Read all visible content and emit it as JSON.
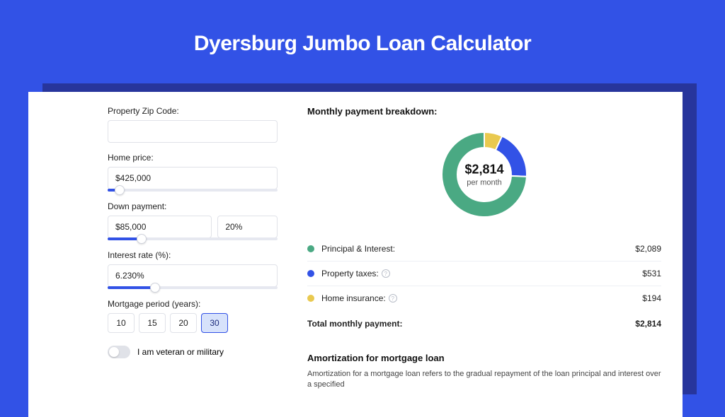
{
  "page": {
    "title": "Dyersburg Jumbo Loan Calculator"
  },
  "form": {
    "zip_label": "Property Zip Code:",
    "zip_value": "",
    "home_price_label": "Home price:",
    "home_price_value": "$425,000",
    "home_price_slider_pct": 7,
    "down_label": "Down payment:",
    "down_value": "$85,000",
    "down_pct_value": "20%",
    "down_slider_pct": 20,
    "rate_label": "Interest rate (%):",
    "rate_value": "6.230%",
    "rate_slider_pct": 28,
    "period_label": "Mortgage period (years):",
    "periods": [
      "10",
      "15",
      "20",
      "30"
    ],
    "period_active": "30",
    "veteran_label": "I am veteran or military",
    "veteran_on": false
  },
  "breakdown": {
    "title": "Monthly payment breakdown:",
    "total_amount": "$2,814",
    "total_sub": "per month",
    "items": [
      {
        "label": "Principal & Interest:",
        "amount": "$2,089",
        "color": "#4aa983",
        "has_info": false
      },
      {
        "label": "Property taxes:",
        "amount": "$531",
        "color": "#3252e6",
        "has_info": true
      },
      {
        "label": "Home insurance:",
        "amount": "$194",
        "color": "#e9c94f",
        "has_info": true
      }
    ],
    "total_label": "Total monthly payment:",
    "total_value": "$2,814"
  },
  "chart_data": {
    "type": "pie",
    "title": "Monthly payment breakdown",
    "series": [
      {
        "name": "Principal & Interest",
        "value": 2089,
        "color": "#4aa983"
      },
      {
        "name": "Property taxes",
        "value": 531,
        "color": "#3252e6"
      },
      {
        "name": "Home insurance",
        "value": 194,
        "color": "#e9c94f"
      }
    ],
    "total": 2814,
    "inner_label": "$2,814",
    "inner_sub": "per month"
  },
  "amort": {
    "title": "Amortization for mortgage loan",
    "text": "Amortization for a mortgage loan refers to the gradual repayment of the loan principal and interest over a specified"
  }
}
